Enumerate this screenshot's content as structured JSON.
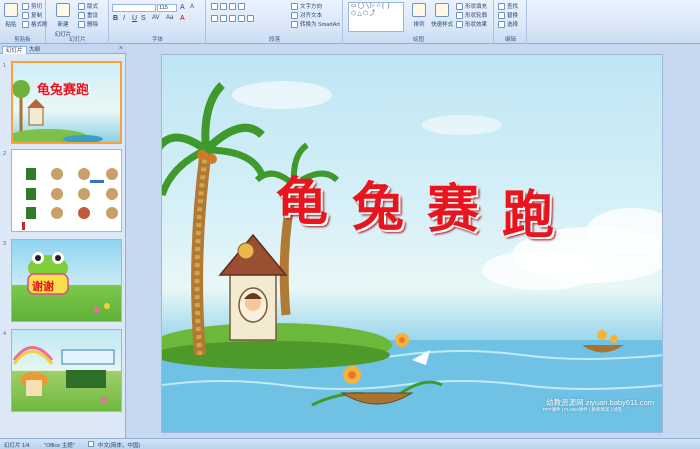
{
  "ribbon": {
    "clipboard": {
      "label": "剪贴板",
      "paste": "粘贴",
      "cut": "剪切",
      "copy": "复制",
      "format_painter": "格式刷"
    },
    "slides": {
      "label": "幻灯片",
      "new_slide": "新建",
      "new_slide2": "幻灯片",
      "layout": "版式",
      "reset": "重设",
      "delete": "删除"
    },
    "font": {
      "label": "字体",
      "font_name": "",
      "font_size": "115"
    },
    "paragraph": {
      "label": "段落",
      "text_direction": "文字方向",
      "align_text": "对齐文本",
      "smartart": "转换为 SmartArt"
    },
    "drawing": {
      "label": "绘图",
      "arrange": "排列",
      "quick_styles": "快速样式",
      "shape_fill": "形状填充",
      "shape_outline": "形状轮廓",
      "shape_effects": "形状效果",
      "shapes_preview": "▭◯╲▷☆{ }⬡△⬠⤴"
    },
    "editing": {
      "label": "编辑",
      "find": "查找",
      "replace": "替换",
      "select": "选择"
    }
  },
  "pane": {
    "tab_slides": "幻灯片",
    "tab_outline": "大纲",
    "close": "×",
    "thumbs": [
      {
        "num": "1",
        "title": "龟兔赛跑"
      },
      {
        "num": "2",
        "title": ""
      },
      {
        "num": "3",
        "title": "谢谢"
      },
      {
        "num": "4",
        "title": ""
      }
    ]
  },
  "slide": {
    "title_chars": [
      "龟",
      "兔",
      "赛",
      "跑"
    ],
    "watermark": "幼教资源网 ziyuan.baby611.com",
    "watermark_sub": "PPT课件 | FLASH课件 | 教师教案 | 试卷"
  },
  "status": {
    "slide_info": "幻灯片 1/4",
    "theme": "\"Office 主题\"",
    "language": "中文(简体，中国)"
  },
  "colors": {
    "title_red": "#e8141e",
    "selection_orange": "#f6a43a",
    "ribbon_blue": "#dbe8f8"
  }
}
